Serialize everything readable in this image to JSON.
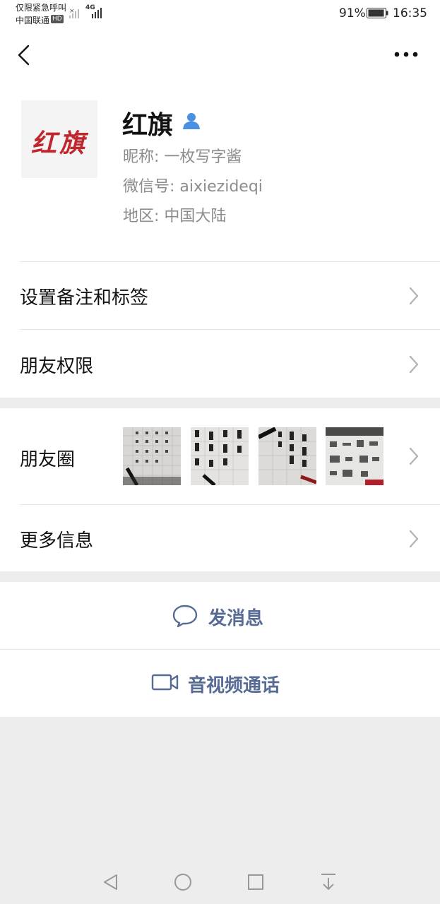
{
  "status_bar": {
    "line1": "仅限紧急呼叫",
    "carrier": "中国联通",
    "hd": "HD",
    "network": "4G",
    "battery": "91%",
    "time": "16:35"
  },
  "profile": {
    "name": "红旗",
    "avatar_text": "红旗",
    "nickname": "昵称:  一枚写字酱",
    "wechat_id": "微信号:  aixiezideqi",
    "region": "地区:  中国大陆"
  },
  "rows": {
    "remark": "设置备注和标签",
    "permissions": "朋友权限",
    "moments": "朋友圈",
    "more_info": "更多信息"
  },
  "actions": {
    "message": "发消息",
    "video_call": "音视频通话"
  },
  "colors": {
    "link": "#576b95",
    "background": "#ededed",
    "avatar_red": "#c0272d",
    "verified_blue": "#4a90e2"
  },
  "icons": [
    "back-icon",
    "more-icon",
    "verified-icon",
    "chevron-right-icon",
    "chat-bubble-icon",
    "video-camera-icon",
    "nav-back-icon",
    "nav-home-icon",
    "nav-recents-icon",
    "nav-notification-icon"
  ]
}
